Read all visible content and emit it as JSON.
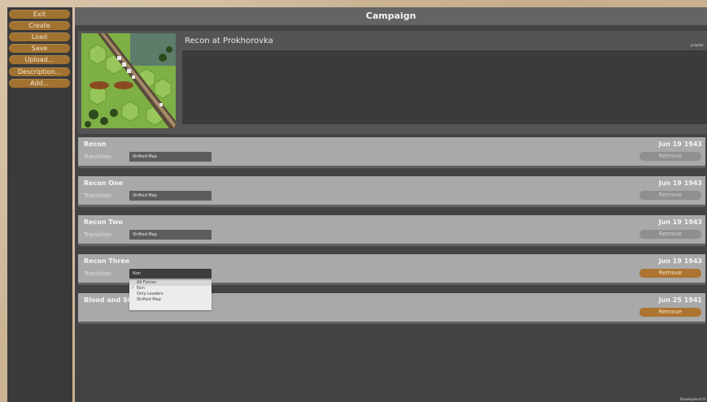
{
  "menu": {
    "items": [
      {
        "label": "Exit"
      },
      {
        "label": "Create"
      },
      {
        "label": "Load"
      },
      {
        "label": "Save"
      },
      {
        "label": "Upload..."
      },
      {
        "label": "Description..."
      },
      {
        "label": "Add..."
      }
    ]
  },
  "title": "Campaign",
  "campaign": {
    "name": "Recon at Prokhorovka",
    "author": "js-bader"
  },
  "transition_label": "Transition",
  "remove_label": "Remove",
  "missions": [
    {
      "name": "Recon",
      "date": "Jun 19 1943",
      "transition": "Shifted Map"
    },
    {
      "name": "Recon One",
      "date": "Jun 19 1943",
      "transition": "Shifted Map"
    },
    {
      "name": "Recon Two",
      "date": "Jun 19 1943",
      "transition": "Shifted Map"
    },
    {
      "name": "Recon Three",
      "date": "Jun 19 1943",
      "transition": "Non"
    },
    {
      "name": "Blood and St",
      "date": "Jun 25 1941"
    }
  ],
  "dropdown": {
    "options": [
      "All Forces",
      "Non",
      "Only Leaders",
      "Shifted Map"
    ],
    "selected": "Non"
  },
  "footer": "Development B",
  "colors": {
    "accent": "#a27230",
    "panel": "#434343",
    "mission_bg": "#a9a9a9"
  }
}
